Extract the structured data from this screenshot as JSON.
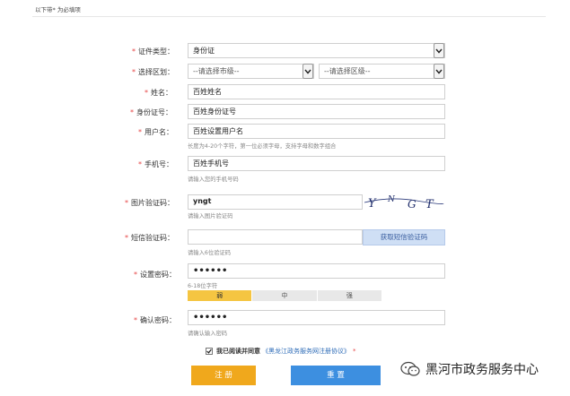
{
  "top_note": "以下带* 为必填项",
  "form": {
    "id_type": {
      "label": "证件类型：",
      "value": "身份证"
    },
    "region": {
      "label": "选择区划：",
      "city_value": "--请选择市级--",
      "district_value": "--请选择区级--"
    },
    "name": {
      "label": "姓名：",
      "value": "百姓姓名"
    },
    "id_number": {
      "label": "身份证号：",
      "value": "百姓身份证号"
    },
    "username": {
      "label": "用户名：",
      "value": "百姓设置用户名",
      "hint": "长度为4-20个字符，第一位必须字母，支持字母和数字组合"
    },
    "phone": {
      "label": "手机号：",
      "value": "百姓手机号",
      "hint": "请输入您的手机号码"
    },
    "captcha": {
      "label": "图片验证码：",
      "value": "yngt",
      "hint": "请输入图片验证码",
      "image_text": "YNGT"
    },
    "sms": {
      "label": "短信验证码：",
      "value": "",
      "button": "获取短信验证码",
      "hint": "请输入6位验证码"
    },
    "password": {
      "label": "设置密码：",
      "value": "••••••",
      "hint": "6-18位字符",
      "strength": [
        "弱",
        "中",
        "强"
      ],
      "strength_level": "弱"
    },
    "confirm": {
      "label": "确认密码：",
      "value": "••••••",
      "hint": "请确认输入密码"
    }
  },
  "agreement": {
    "text": "我已阅读并同意",
    "link": "《黑龙江政务服务网注册协议》",
    "checked": true
  },
  "buttons": {
    "register": "注 册",
    "reset": "重 置"
  },
  "watermark": {
    "text": "黑河市政务服务中心"
  },
  "colors": {
    "required": "#e64545",
    "register": "#f0a81c",
    "reset": "#3d8fe0",
    "weak": "#f5c542",
    "sms_button": "#cfdff5"
  }
}
